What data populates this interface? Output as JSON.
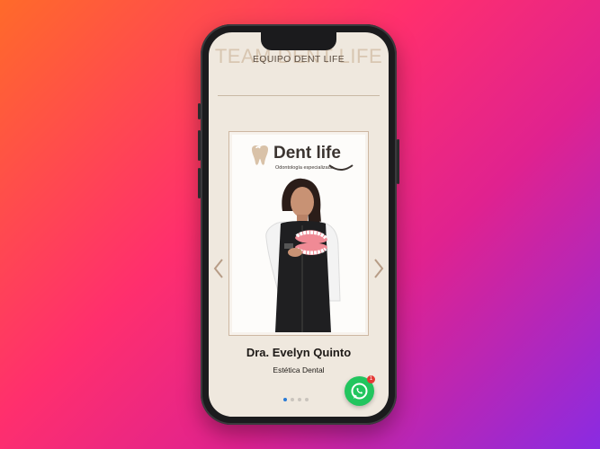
{
  "section": {
    "ghost_title": "TEAM DENT LIFE",
    "title": "EQUIPO DENT LIFE"
  },
  "logo": {
    "name": "Dent life",
    "tagline": "Odontología especializada"
  },
  "member": {
    "name": "Dra. Evelyn Quinto",
    "role": "Estética Dental"
  },
  "carousel": {
    "prev_icon": "chevron-left-icon",
    "next_icon": "chevron-right-icon",
    "dots": 4,
    "active_dot": 1
  },
  "whatsapp": {
    "icon": "whatsapp-icon",
    "badge": "1",
    "color": "#22c55e"
  },
  "colors": {
    "screen_bg": "#efe8de",
    "accent_border": "#cdb7a2",
    "active_dot": "#2a7bd6"
  }
}
